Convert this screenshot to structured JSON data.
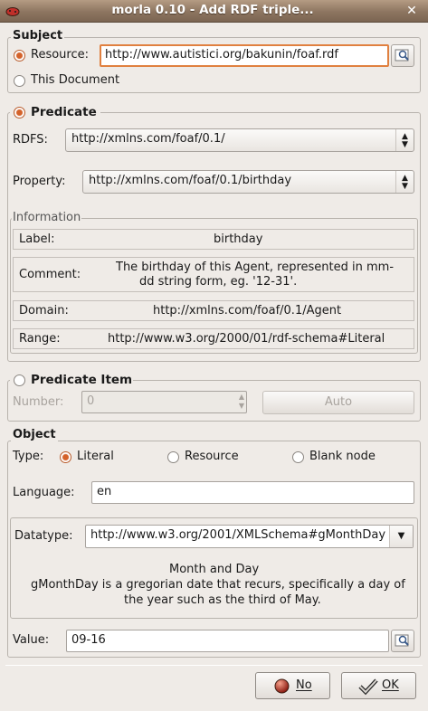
{
  "window": {
    "title": "morla 0.10 - Add RDF triple...",
    "close_glyph": "✕",
    "app_icon": "morla-ladybug-icon"
  },
  "subject": {
    "title": "Subject",
    "resource_label": "Resource:",
    "resource_value": "http://www.autistici.org/bakunin/foaf.rdf",
    "resource_selected": true,
    "this_document_label": "This Document"
  },
  "predicate": {
    "title": "Predicate",
    "rdfs_label": "RDFS:",
    "rdfs_value": "http://xmlns.com/foaf/0.1/",
    "property_label": "Property:",
    "property_value": "http://xmlns.com/foaf/0.1/birthday",
    "information": {
      "title": "Information",
      "label_key": "Label:",
      "label_value": "birthday",
      "comment_key": "Comment:",
      "comment_line1": "The birthday of this Agent, represented in mm-",
      "comment_line2": "dd string form, eg. '12-31'.",
      "domain_key": "Domain:",
      "domain_value": "http://xmlns.com/foaf/0.1/Agent",
      "range_key": "Range:",
      "range_value": "http://www.w3.org/2000/01/rdf-schema#Literal"
    }
  },
  "predicate_item": {
    "title": "Predicate Item",
    "number_label": "Number:",
    "number_value": "0",
    "auto_label": "Auto"
  },
  "object": {
    "title": "Object",
    "type_label": "Type:",
    "types": [
      "Literal",
      "Resource",
      "Blank node"
    ],
    "selected_type": "Literal",
    "language_label": "Language:",
    "language_value": "en",
    "datatype_label": "Datatype:",
    "datatype_value": "http://www.w3.org/2001/XMLSchema#gMonthDay",
    "datatype_heading": "Month and Day",
    "datatype_desc1": "gMonthDay is a gregorian date that recurs, specifically a day of",
    "datatype_desc2": "the year such as the third of May.",
    "value_label": "Value:",
    "value": "09-16"
  },
  "buttons": {
    "no_label": "No",
    "ok_label": "OK"
  },
  "colors": {
    "titlebar": "#8d7560",
    "focus_border": "#e08040",
    "radio_selected": "#d4622a"
  }
}
